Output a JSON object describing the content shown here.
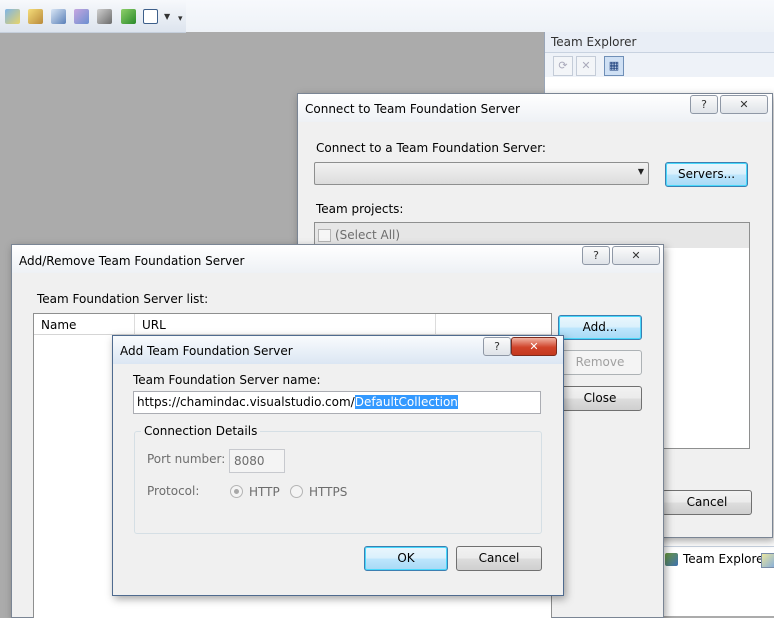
{
  "team_explorer": {
    "title": "Team Explorer",
    "tab_label": "Team Explorer"
  },
  "connect_dialog": {
    "title": "Connect to Team Foundation Server",
    "help_glyph": "?",
    "close_glyph": "✕",
    "server_label": "Connect to a Team Foundation Server:",
    "servers_button": "Servers...",
    "projects_label": "Team projects:",
    "select_all": "(Select All)",
    "cancel_button": "Cancel"
  },
  "add_remove_dialog": {
    "title": "Add/Remove Team Foundation Server",
    "help_glyph": "?",
    "close_glyph": "✕",
    "list_label": "Team Foundation Server list:",
    "columns": [
      "Name",
      "URL"
    ],
    "add_button": "Add...",
    "remove_button": "Remove",
    "close_button": "Close"
  },
  "add_dialog": {
    "title": "Add Team Foundation Server",
    "help_glyph": "?",
    "close_glyph": "✕",
    "name_label": "Team Foundation Server name:",
    "url_prefix": "https://chamindac.visualstudio.com/",
    "url_selected": "DefaultCollection",
    "group_label": "Connection Details",
    "port_label": "Port number:",
    "port_value": "8080",
    "protocol_label": "Protocol:",
    "protocol_options": [
      "HTTP",
      "HTTPS"
    ],
    "ok_button": "OK",
    "cancel_button": "Cancel"
  }
}
